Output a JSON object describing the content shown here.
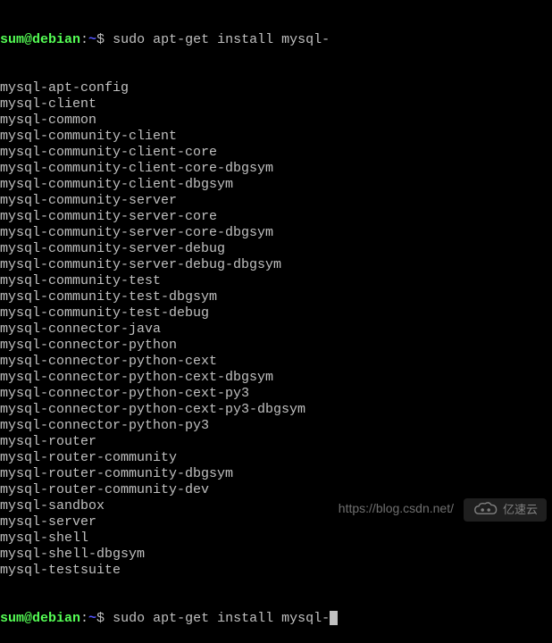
{
  "prompt": {
    "user_host": "sum@debian",
    "colon": ":",
    "path": "~",
    "symbol": "$ "
  },
  "command_top": "sudo apt-get install mysql-",
  "command_bottom": "sudo apt-get install mysql-",
  "completions": [
    "mysql-apt-config",
    "mysql-client",
    "mysql-common",
    "mysql-community-client",
    "mysql-community-client-core",
    "mysql-community-client-core-dbgsym",
    "mysql-community-client-dbgsym",
    "mysql-community-server",
    "mysql-community-server-core",
    "mysql-community-server-core-dbgsym",
    "mysql-community-server-debug",
    "mysql-community-server-debug-dbgsym",
    "mysql-community-test",
    "mysql-community-test-dbgsym",
    "mysql-community-test-debug",
    "mysql-connector-java",
    "mysql-connector-python",
    "mysql-connector-python-cext",
    "mysql-connector-python-cext-dbgsym",
    "mysql-connector-python-cext-py3",
    "mysql-connector-python-cext-py3-dbgsym",
    "mysql-connector-python-py3",
    "mysql-router",
    "mysql-router-community",
    "mysql-router-community-dbgsym",
    "mysql-router-community-dev",
    "mysql-sandbox",
    "mysql-server",
    "mysql-shell",
    "mysql-shell-dbgsym",
    "mysql-testsuite"
  ],
  "watermark": {
    "url": "https://blog.csdn.net/",
    "brand": "亿速云"
  }
}
